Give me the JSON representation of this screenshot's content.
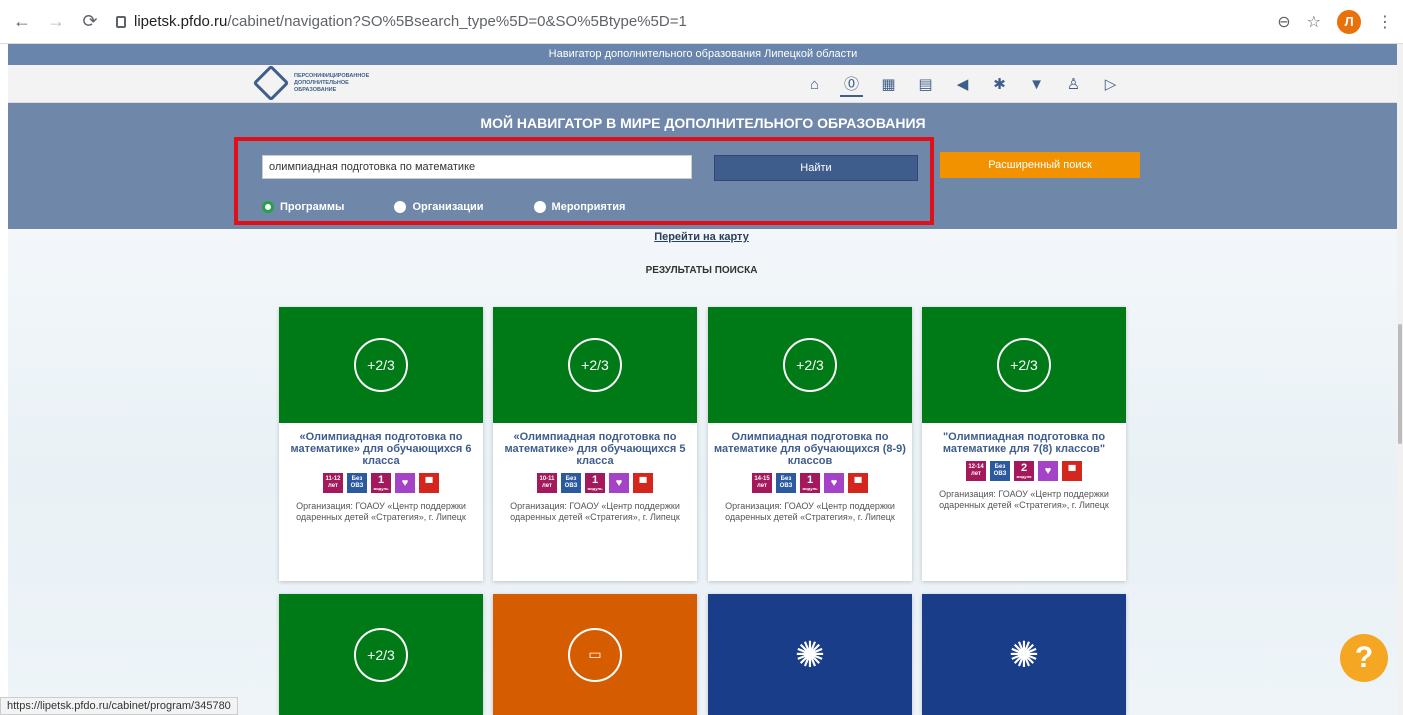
{
  "browser": {
    "url_host": "lipetsk.pfdo.ru",
    "url_path": "/cabinet/navigation?SO%5Bsearch_type%5D=0&SO%5Btype%5D=1",
    "avatar_letter": "Л"
  },
  "site": {
    "top_strip": "Навигатор дополнительного образования Липецкой области",
    "logo_lines": [
      "ПЕРСОНИФИЦИРОВАННОЕ",
      "ДОПОЛНИТЕЛЬНОЕ",
      "ОБРАЗОВАНИЕ"
    ],
    "nav_icons": [
      "home-icon",
      "ruble-icon",
      "calendar-icon",
      "document-icon",
      "megaphone-icon",
      "star-icon",
      "trophy-icon",
      "people-icon",
      "exit-icon"
    ]
  },
  "search": {
    "title": "МОЙ НАВИГАТОР В МИРЕ ДОПОЛНИТЕЛЬНОГО ОБРАЗОВАНИЯ",
    "query": "олимпиадная подготовка по математике",
    "find_label": "Найти",
    "advanced_label": "Расширенный поиск",
    "radios": [
      {
        "label": "Программы",
        "checked": true
      },
      {
        "label": "Организации",
        "checked": false
      },
      {
        "label": "Мероприятия",
        "checked": false
      }
    ]
  },
  "map_link": "Перейти на карту",
  "results_heading": "РЕЗУЛЬТАТЫ ПОИСКА",
  "cards": [
    {
      "title": "«Олимпиадная подготовка по математике» для обучающихся 6 класса",
      "age": "11-12",
      "age_unit": "лет",
      "ovz_top": "Без",
      "ovz_bottom": "ОВЗ",
      "modules": "1",
      "modules_unit": "модуль",
      "org": "Организация: ГОАОУ «Центр поддержки одаренных детей «Стратегия», г. Липецк"
    },
    {
      "title": "«Олимпиадная подготовка по математике» для обучающихся 5 класса",
      "age": "10-11",
      "age_unit": "лет",
      "ovz_top": "Без",
      "ovz_bottom": "ОВЗ",
      "modules": "1",
      "modules_unit": "модуль",
      "org": "Организация: ГОАОУ «Центр поддержки одаренных детей «Стратегия», г. Липецк"
    },
    {
      "title": "Олимпиадная подготовка по математике для обучающихся (8-9) классов",
      "age": "14-15",
      "age_unit": "лет",
      "ovz_top": "Без",
      "ovz_bottom": "ОВЗ",
      "modules": "1",
      "modules_unit": "модуль",
      "org": "Организация: ГОАОУ «Центр поддержки одаренных детей «Стратегия», г. Липецк"
    },
    {
      "title": "\"Олимпиадная подготовка по математике для 7(8) классов\"",
      "age": "12-14",
      "age_unit": "лет",
      "ovz_top": "Без",
      "ovz_bottom": "ОВЗ",
      "modules": "2",
      "modules_unit": "модуля",
      "org": "Организация: ГОАОУ «Центр поддержки одаренных детей «Стратегия», г. Липецк"
    }
  ],
  "math_glyph": "+2/3",
  "status_url": "https://lipetsk.pfdo.ru/cabinet/program/345780",
  "help_label": "?"
}
